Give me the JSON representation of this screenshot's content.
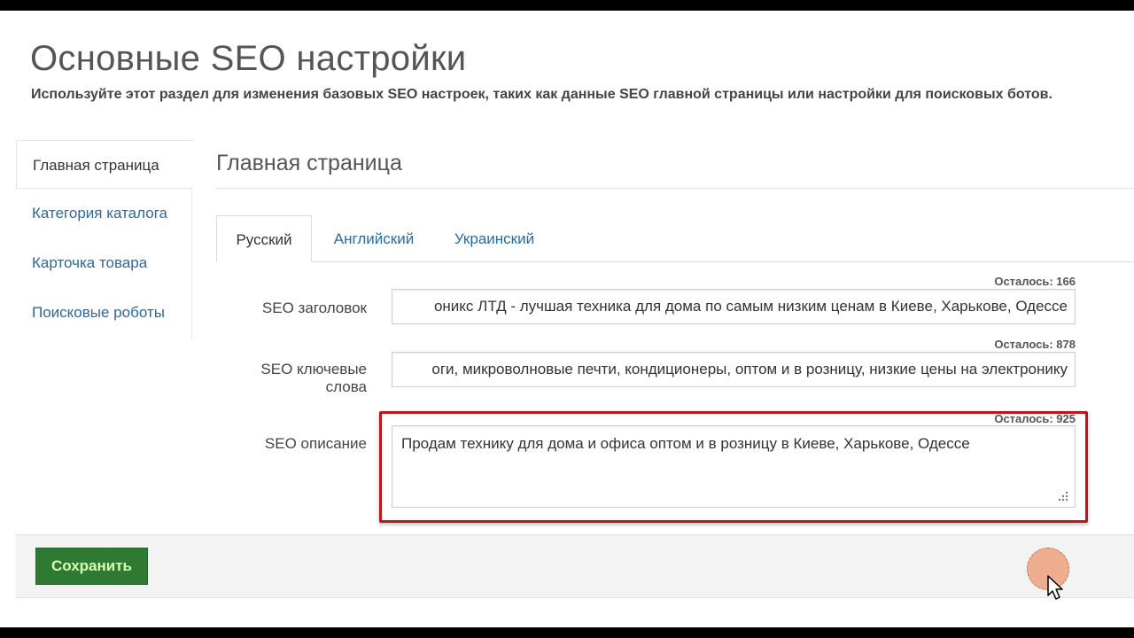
{
  "page": {
    "title": "Основные SEO настройки",
    "subtitle": "Используйте этот раздел для изменения базовых SEO настроек, таких как данные SEO главной страницы или настройки для поисковых ботов."
  },
  "sidebar": {
    "items": [
      {
        "label": "Главная страница",
        "active": true
      },
      {
        "label": "Категория каталога",
        "active": false
      },
      {
        "label": "Карточка товара",
        "active": false
      },
      {
        "label": "Поисковые роботы",
        "active": false
      }
    ]
  },
  "section": {
    "title": "Главная страница"
  },
  "tabs": [
    {
      "label": "Русский",
      "active": true
    },
    {
      "label": "Английский",
      "active": false
    },
    {
      "label": "Украинский",
      "active": false
    }
  ],
  "fields": {
    "seo_title": {
      "label": "SEO заголовок",
      "counter": "Осталось: 166",
      "value": "оникс ЛТД - лучшая техника для дома по самым низким ценам в Киеве, Харькове, Одессе"
    },
    "seo_keywords": {
      "label": "SEO ключевые слова",
      "counter": "Осталось: 878",
      "value": "оги, микроволновые печти, кондиционеры, оптом и в розницу, низкие цены на электронику"
    },
    "seo_description": {
      "label": "SEO описание",
      "counter": "Осталось: 925",
      "value": "Продам технику для дома и офиса оптом и в розницу в Киеве, Харькове, Одессе"
    }
  },
  "footer": {
    "save_label": "Сохранить"
  },
  "colors": {
    "link": "#2a6a9e",
    "save_button": "#2f7a32",
    "highlight": "#c4121a"
  }
}
